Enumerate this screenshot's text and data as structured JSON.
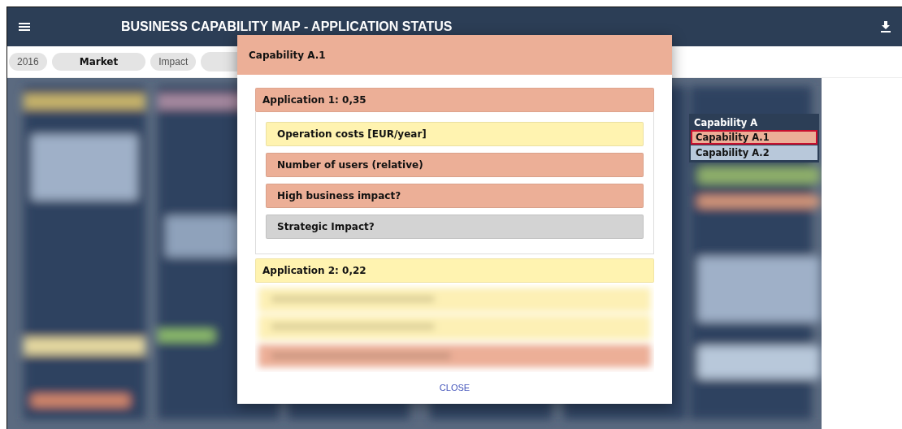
{
  "header": {
    "title": "BUSINESS CAPABILITY MAP - APPLICATION STATUS"
  },
  "filters": [
    {
      "label": "2016",
      "selected": false
    },
    {
      "label": "Market",
      "selected": true
    },
    {
      "label": "Impact",
      "selected": false
    }
  ],
  "legend": {
    "title": "Capability A",
    "items": [
      {
        "label": "Capability A.1",
        "color": "#ecaf97",
        "selected": true
      },
      {
        "label": "Capability A.2",
        "color": "#b8c8da",
        "selected": false
      }
    ]
  },
  "dialog": {
    "title": "Capability A.1",
    "applications": [
      {
        "label": "Application 1: 0,35",
        "color": "#ecaf97",
        "expanded": true,
        "criteria": [
          {
            "label": "Operation costs [EUR/year]",
            "color": "#fff3b0"
          },
          {
            "label": "Number of users (relative)",
            "color": "#ecaf97"
          },
          {
            "label": "High business impact?",
            "color": "#ecaf97"
          },
          {
            "label": "Strategic Impact?",
            "color": "#d3d3d3"
          }
        ]
      },
      {
        "label": "Application 2: 0,22",
        "color": "#fff3b0",
        "expanded": true
      }
    ],
    "close": "CLOSE"
  }
}
